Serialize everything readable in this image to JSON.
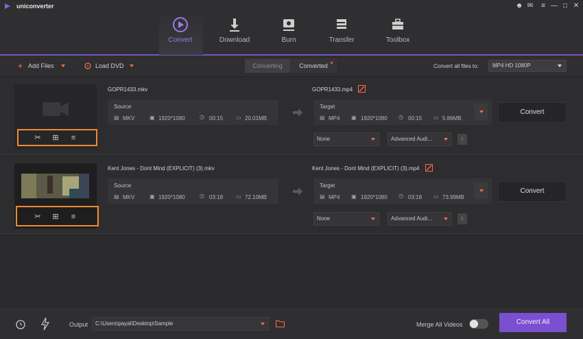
{
  "app": {
    "name": "uniconverter"
  },
  "tabs": [
    {
      "label": "Convert",
      "active": true,
      "icon": "play-circle-icon"
    },
    {
      "label": "Download",
      "active": false,
      "icon": "download-icon"
    },
    {
      "label": "Burn",
      "active": false,
      "icon": "disc-icon"
    },
    {
      "label": "Transfer",
      "active": false,
      "icon": "transfer-icon"
    },
    {
      "label": "Toolbox",
      "active": false,
      "icon": "toolbox-icon"
    }
  ],
  "toolbar": {
    "add_files": "Add Files",
    "load_dvd": "Load DVD",
    "converting": "Converting",
    "converted": "Converted",
    "convert_all_to_label": "Convert all files to:",
    "convert_all_to_value": "MP4 HD 1080P"
  },
  "items": [
    {
      "source_name": "GOPR1433.mkv",
      "target_name": "GOPR1433.mp4",
      "source": {
        "label": "Source",
        "format": "MKV",
        "resolution": "1920*1080",
        "duration": "00:15",
        "size": "20.01MB"
      },
      "target": {
        "label": "Target",
        "format": "MP4",
        "resolution": "1920*1080",
        "duration": "00:15",
        "size": "5.86MB"
      },
      "subtitle": "None",
      "audio": "Advanced Audi...",
      "convert_label": "Convert"
    },
    {
      "source_name": "Kent Jones - Dont Mind (EXPLICIT) (3).mkv",
      "target_name": "Kent Jones - Dont Mind (EXPLICIT) (3).mp4",
      "source": {
        "label": "Source",
        "format": "MKV",
        "resolution": "1920*1080",
        "duration": "03:18",
        "size": "72.10MB"
      },
      "target": {
        "label": "Target",
        "format": "MP4",
        "resolution": "1920*1080",
        "duration": "03:18",
        "size": "73.99MB"
      },
      "subtitle": "None",
      "audio": "Advanced Audi...",
      "convert_label": "Convert"
    }
  ],
  "bottom": {
    "output_label": "Output",
    "output_path": "C:\\Users\\payal\\Desktop\\Sample",
    "merge_label": "Merge All Videos",
    "merge_on": false,
    "convert_all": "Convert All"
  },
  "colors": {
    "accent": "#7b52c9",
    "highlight": "#f08a32",
    "warn": "#ff6b4a"
  }
}
